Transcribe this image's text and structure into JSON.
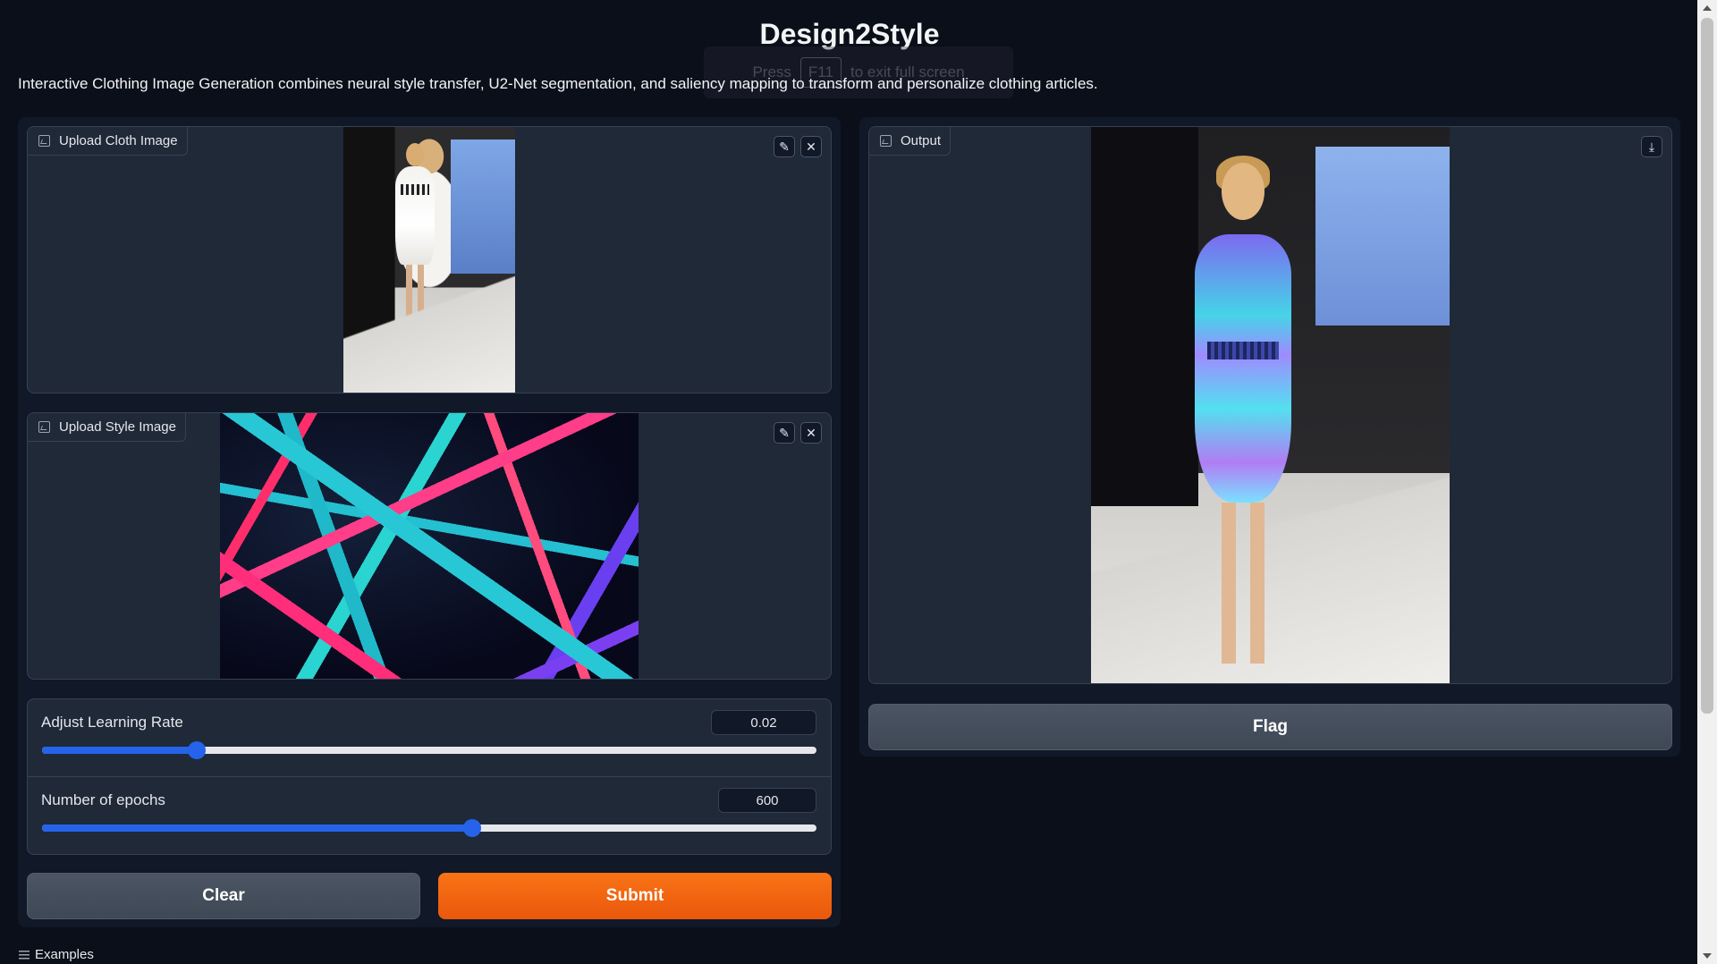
{
  "header": {
    "title": "Design2Style",
    "description": "Interactive Clothing Image Generation combines neural style transfer, U2-Net segmentation, and saliency mapping to transform and personalize clothing articles.",
    "fullscreen_hint": {
      "prefix": "Press",
      "key": "F11",
      "suffix": "to exit full screen"
    }
  },
  "inputs": {
    "cloth": {
      "label": "Upload Cloth Image",
      "image_icon": "image-icon",
      "edit_icon": "pencil-icon",
      "clear_icon": "close-icon"
    },
    "style": {
      "label": "Upload Style Image",
      "image_icon": "image-icon",
      "edit_icon": "pencil-icon",
      "clear_icon": "close-icon"
    }
  },
  "sliders": {
    "learning_rate": {
      "label": "Adjust Learning Rate",
      "value": "0.02",
      "fraction": 0.2
    },
    "epochs": {
      "label": "Number of epochs",
      "value": "600",
      "fraction": 0.555
    }
  },
  "buttons": {
    "clear": "Clear",
    "submit": "Submit",
    "flag": "Flag"
  },
  "output": {
    "label": "Output",
    "image_icon": "image-icon",
    "download_icon": "download-icon"
  },
  "examples": {
    "label": "Examples",
    "icon": "list-icon"
  },
  "colors": {
    "accent": "#f97316",
    "slider": "#2563eb",
    "panel": "#1f2937",
    "background": "#0b0f19"
  }
}
